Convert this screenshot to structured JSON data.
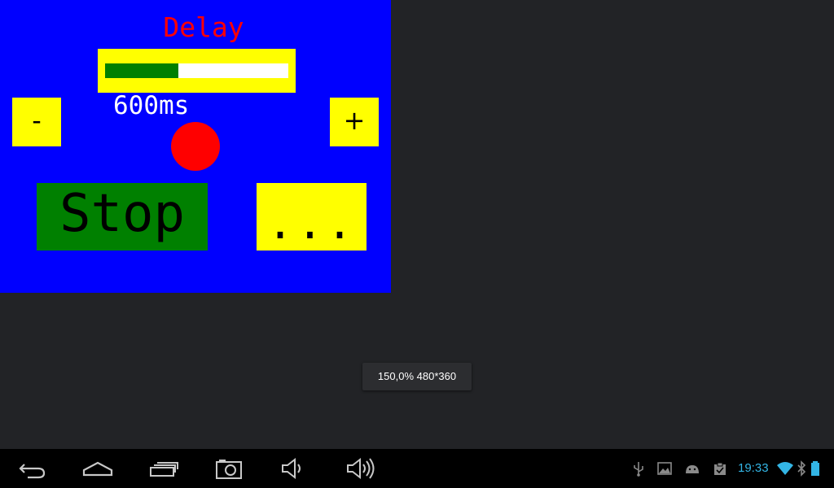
{
  "app": {
    "title": "Delay",
    "slider_fraction": 0.4,
    "value_text": "600ms",
    "minus_label": "-",
    "plus_label": "+",
    "stop_label": "Stop",
    "more_label": "...",
    "colors": {
      "background": "#0000ff",
      "title": "#ff0000",
      "button": "#ffff00",
      "slider_fill": "#008000",
      "stop_button": "#008000",
      "indicator": "#ff0000"
    }
  },
  "toast": {
    "text": "150,0% 480*360"
  },
  "navbar": {
    "buttons": [
      "back-icon",
      "home-icon",
      "recent-apps-icon",
      "screenshot-icon",
      "volume-down-icon",
      "volume-up-icon"
    ]
  },
  "status_bar": {
    "icons": [
      "usb-icon",
      "gallery-icon",
      "android-debug-icon",
      "clipboard-icon",
      "wifi-icon",
      "bluetooth-icon",
      "battery-icon"
    ],
    "clock": "19:33",
    "clock_color": "#33b5e5"
  }
}
